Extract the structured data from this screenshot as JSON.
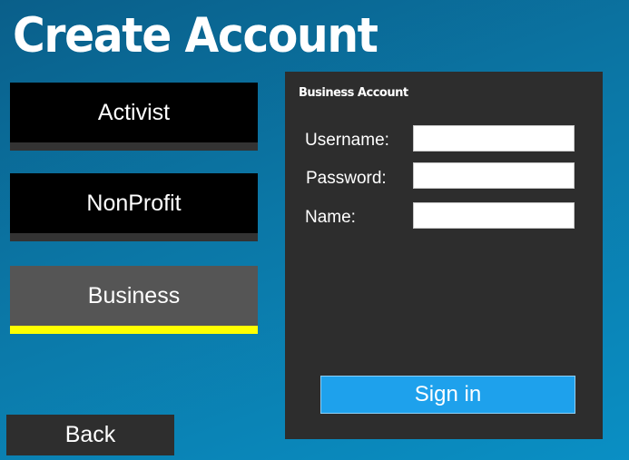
{
  "header": {
    "title": "Create Account"
  },
  "account_types": {
    "items": [
      {
        "label": "Activist",
        "selected": false
      },
      {
        "label": "NonProfit",
        "selected": false
      },
      {
        "label": "Business",
        "selected": true
      }
    ]
  },
  "form": {
    "title": "Business Account",
    "username_label": "Username:",
    "password_label": "Password:",
    "name_label": "Name:",
    "username_value": "",
    "password_value": "",
    "name_value": "",
    "submit_label": "Sign in"
  },
  "nav": {
    "back_label": "Back"
  },
  "colors": {
    "background": "#0b77a6",
    "button_bg": "#000000",
    "selected_bg": "#555555",
    "selected_indicator": "#ffff00",
    "panel_bg": "#2d2d2d",
    "submit_bg": "#1ea1ec"
  }
}
